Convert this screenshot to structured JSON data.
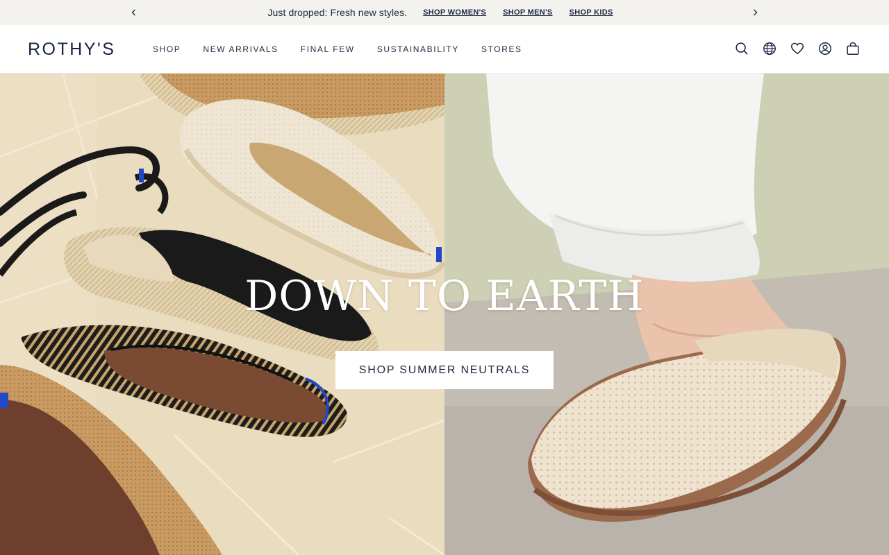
{
  "promo": {
    "text": "Just dropped: Fresh new styles.",
    "links": [
      "SHOP WOMEN'S",
      "SHOP MEN'S",
      "SHOP KIDS"
    ],
    "prev_icon": "chevron-left-icon",
    "next_icon": "chevron-right-icon",
    "background": "#f3f2ef"
  },
  "header": {
    "logo": "ROTHY'S",
    "nav": [
      "SHOP",
      "NEW ARRIVALS",
      "FINAL FEW",
      "SUSTAINABILITY",
      "STORES"
    ],
    "icons": [
      "search-icon",
      "globe-icon",
      "heart-icon",
      "account-icon",
      "bag-icon"
    ]
  },
  "hero": {
    "title": "DOWN TO EARTH",
    "cta": "SHOP SUMMER NEUTRALS",
    "left_image": "flat-lay of espadrilles, ballet flats and slingbacks on tile",
    "right_image": "knit clog on foot with cuffed white trousers"
  },
  "colors": {
    "navy": "#15233f",
    "text": "#1d2a3e",
    "white": "#ffffff"
  }
}
